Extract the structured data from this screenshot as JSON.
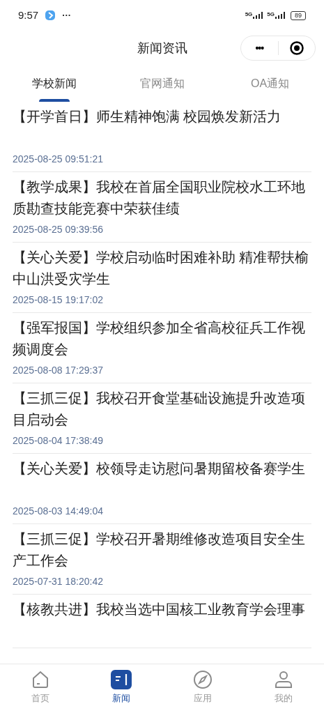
{
  "status_bar": {
    "time": "9:57",
    "more": "···",
    "network_1": "5G",
    "network_2": "5G",
    "battery": "89"
  },
  "header": {
    "title": "新闻资讯",
    "menu": "•••"
  },
  "tabs": [
    {
      "label": "学校新闻",
      "selected": true
    },
    {
      "label": "官网通知",
      "selected": false
    },
    {
      "label": "OA通知",
      "selected": false
    }
  ],
  "news": [
    {
      "title": "【开学首日】师生精神饱满 校园焕发新活力",
      "date": "2025-08-25 09:51:21"
    },
    {
      "title": "【教学成果】我校在首届全国职业院校水工环地质勘查技能竞赛中荣获佳绩",
      "date": "2025-08-25 09:39:56"
    },
    {
      "title": "【关心关爱】学校启动临时困难补助 精准帮扶榆中山洪受灾学生",
      "date": "2025-08-15 19:17:02"
    },
    {
      "title": "【强军报国】学校组织参加全省高校征兵工作视频调度会",
      "date": "2025-08-08 17:29:37"
    },
    {
      "title": "【三抓三促】我校召开食堂基础设施提升改造项目启动会",
      "date": "2025-08-04 17:38:49"
    },
    {
      "title": "【关心关爱】校领导走访慰问暑期留校备赛学生",
      "date": "2025-08-03 14:49:04"
    },
    {
      "title": "【三抓三促】学校召开暑期维修改造项目安全生产工作会",
      "date": "2025-07-31 18:20:42"
    },
    {
      "title": "【核教共进】我校当选中国核工业教育学会理事"
    }
  ],
  "bottom_nav": [
    {
      "label": "首页",
      "kind": "home",
      "selected": false
    },
    {
      "label": "新闻",
      "kind": "news",
      "selected": true
    },
    {
      "label": "应用",
      "kind": "compass",
      "selected": false
    },
    {
      "label": "我的",
      "kind": "user",
      "selected": false
    }
  ]
}
